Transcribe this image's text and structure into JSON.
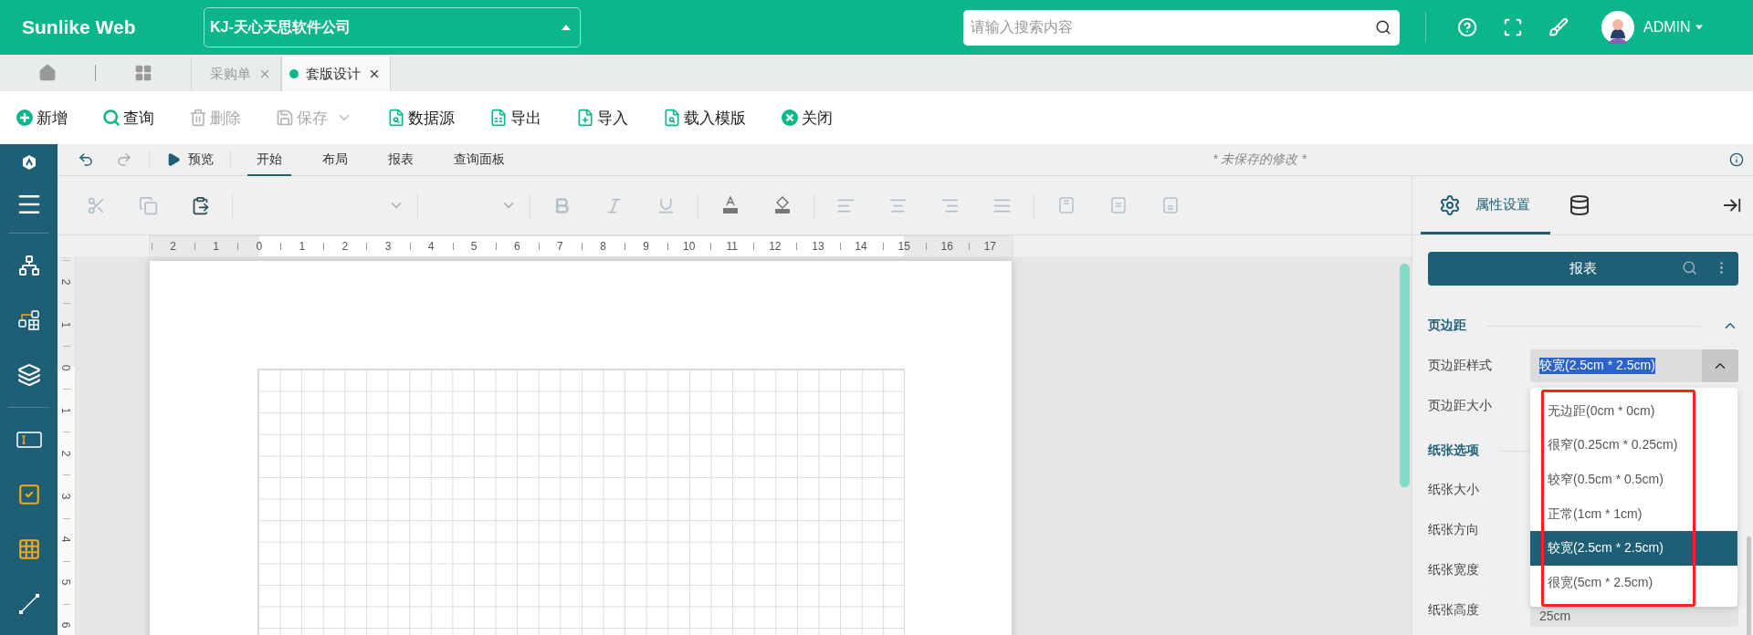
{
  "header": {
    "brand": "Sunlike Web",
    "company": "KJ-天心天思软件公司",
    "search": {
      "placeholder": "请输入搜索内容"
    },
    "user": "ADMIN"
  },
  "page_tabs": [
    {
      "label": "采购单",
      "selected": false
    },
    {
      "label": "套版设计",
      "selected": true
    }
  ],
  "actions": [
    {
      "kind": "add",
      "label": "新增",
      "disabled": false
    },
    {
      "kind": "query",
      "label": "查询",
      "disabled": false
    },
    {
      "kind": "delete",
      "label": "删除",
      "disabled": true
    },
    {
      "kind": "save",
      "label": "保存",
      "disabled": true
    },
    {
      "kind": "datasource",
      "label": "数据源",
      "disabled": false
    },
    {
      "kind": "export",
      "label": "导出",
      "disabled": false
    },
    {
      "kind": "import",
      "label": "导入",
      "disabled": false
    },
    {
      "kind": "template",
      "label": "载入模版",
      "disabled": false
    },
    {
      "kind": "close",
      "label": "关闭",
      "disabled": false
    }
  ],
  "designer": {
    "preview": "预览",
    "redo_disabled": true,
    "tabs": [
      {
        "label": "开始",
        "selected": true
      },
      {
        "label": "布局",
        "selected": false
      },
      {
        "label": "报表",
        "selected": false
      },
      {
        "label": "查询面板",
        "selected": false
      }
    ],
    "note": "* 未保存的修改 *"
  },
  "format_tool_groups": [
    [
      {
        "kind": "cut",
        "disabled": true
      },
      {
        "kind": "copy",
        "disabled": true
      },
      {
        "kind": "paste",
        "disabled": false
      }
    ],
    [
      {
        "kind": "font-select",
        "disabled": true
      },
      {
        "kind": "size-select",
        "disabled": true
      }
    ],
    [
      {
        "kind": "bold",
        "disabled": true
      },
      {
        "kind": "italic",
        "disabled": true
      },
      {
        "kind": "underline",
        "disabled": true
      }
    ],
    [
      {
        "kind": "font-color",
        "disabled": false
      },
      {
        "kind": "fill-color",
        "disabled": false
      }
    ],
    [
      {
        "kind": "align-left",
        "disabled": true
      },
      {
        "kind": "align-center",
        "disabled": true
      },
      {
        "kind": "align-right",
        "disabled": true
      },
      {
        "kind": "justify",
        "disabled": true
      }
    ],
    [
      {
        "kind": "valign-top",
        "disabled": true
      },
      {
        "kind": "valign-middle",
        "disabled": true
      },
      {
        "kind": "valign-bottom",
        "disabled": true
      }
    ]
  ],
  "ruler": {
    "horizontal": [
      "2",
      "1",
      "0",
      "1",
      "2",
      "3",
      "4",
      "5",
      "6",
      "7",
      "8",
      "9",
      "10",
      "11",
      "12",
      "13",
      "14",
      "15",
      "16",
      "17"
    ],
    "vertical": [
      "2",
      "1",
      "0",
      "1",
      "2",
      "3",
      "4",
      "5",
      "6"
    ]
  },
  "panel": {
    "tabs": [
      {
        "kind": "settings",
        "label": "属性设置",
        "selected": true
      },
      {
        "kind": "database",
        "selected": false
      }
    ],
    "report_button": "报表",
    "sections": [
      {
        "title": "页边距",
        "expanded": true,
        "fields": [
          {
            "label": "页边距样式",
            "value": "较宽(2.5cm * 2.5cm)",
            "open": true
          },
          {
            "label": "页边距大小"
          }
        ]
      },
      {
        "title": "纸张选项",
        "fields": [
          {
            "label": "纸张大小"
          },
          {
            "label": "纸张方向"
          },
          {
            "label": "纸张宽度"
          },
          {
            "label": "纸张高度",
            "value": "25cm"
          }
        ]
      }
    ],
    "dropdown": {
      "options": [
        {
          "label": "无边距(0cm * 0cm)",
          "selected": false
        },
        {
          "label": "很窄(0.25cm * 0.25cm)",
          "selected": false
        },
        {
          "label": "较窄(0.5cm * 0.5cm)",
          "selected": false
        },
        {
          "label": "正常(1cm * 1cm)",
          "selected": false
        },
        {
          "label": "较宽(2.5cm * 2.5cm)",
          "selected": true
        },
        {
          "label": "很宽(5cm * 2.5cm)",
          "selected": false
        }
      ]
    }
  }
}
